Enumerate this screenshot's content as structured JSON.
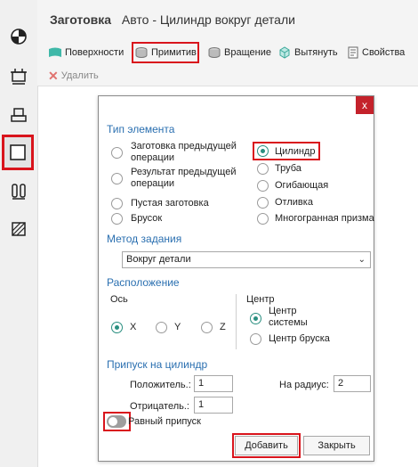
{
  "header": {
    "title": "Заготовка",
    "subtitle": "Авто - Цилиндр вокруг детали"
  },
  "toolbar": {
    "surfaces": "Поверхности",
    "primitive": "Примитив",
    "rotation": "Вращение",
    "extrude": "Вытянуть",
    "properties": "Свойства",
    "delete": "Удалить"
  },
  "dialog": {
    "close_label": "x",
    "element_type": {
      "heading": "Тип элемента",
      "options_left": [
        "Заготовка предыдущей операции",
        "Результат предыдущей операции",
        "Пустая заготовка",
        "Брусок"
      ],
      "options_right": [
        "Цилиндр",
        "Труба",
        "Огибающая",
        "Отливка",
        "Многогранная призма"
      ],
      "selected": "Цилиндр"
    },
    "method": {
      "heading": "Метод задания",
      "value": "Вокруг детали"
    },
    "location": {
      "heading": "Расположение",
      "axis_label": "Ось",
      "axes": [
        "X",
        "Y",
        "Z"
      ],
      "selected_axis": "X",
      "center_label": "Центр",
      "center_options": [
        "Центр системы",
        "Центр бруска"
      ],
      "selected_center": "Центр системы"
    },
    "allowance": {
      "heading": "Припуск на цилиндр",
      "positive_label": "Положитель.:",
      "positive_value": "1",
      "negative_label": "Отрицатель.:",
      "negative_value": "1",
      "radius_label": "На радиус:",
      "radius_value": "2",
      "equal_label": "Равный припуск",
      "equal_enabled": false
    },
    "add_button": "Добавить",
    "close_button": "Закрыть"
  },
  "colors": {
    "accent": "#2a6fb0",
    "highlight": "#d9141c",
    "radio_selected": "#2a8f80",
    "close_button": "#c4222b"
  }
}
